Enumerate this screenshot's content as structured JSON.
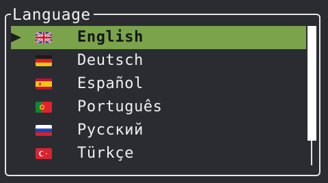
{
  "panel": {
    "title": "Language"
  },
  "languages": [
    {
      "label": "English",
      "flag": "uk-flag-icon",
      "selected": true
    },
    {
      "label": "Deutsch",
      "flag": "germany-flag-icon",
      "selected": false
    },
    {
      "label": "Español",
      "flag": "spain-flag-icon",
      "selected": false
    },
    {
      "label": "Português",
      "flag": "portugal-flag-icon",
      "selected": false
    },
    {
      "label": "Русский",
      "flag": "russia-flag-icon",
      "selected": false
    },
    {
      "label": "Türkçe",
      "flag": "turkey-flag-icon",
      "selected": false
    }
  ],
  "colors": {
    "background": "#2b2c31",
    "selection": "#7aa34b",
    "border": "#e6e6e6"
  }
}
